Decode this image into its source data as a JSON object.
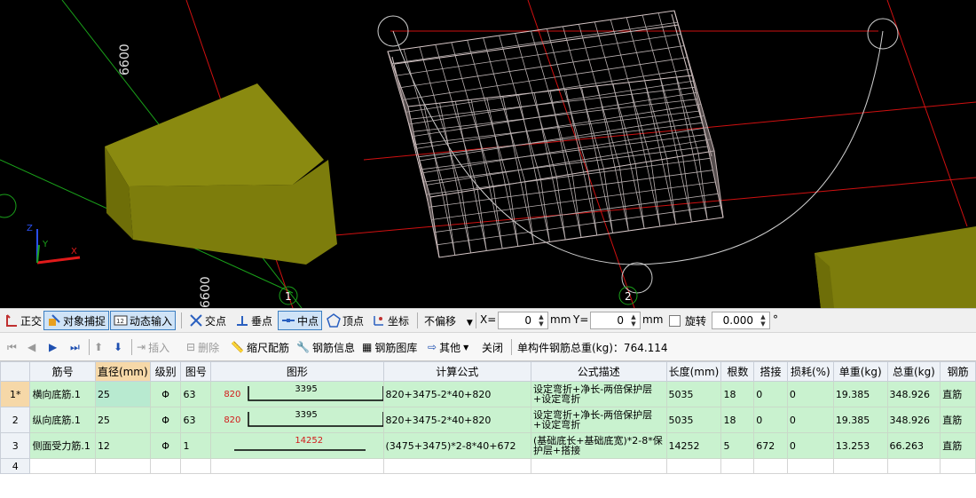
{
  "viewport": {
    "dim_labels": [
      "6600",
      "6600"
    ],
    "axis_labels": {
      "z": "Z",
      "y": "Y",
      "x": "X"
    },
    "grid_bubbles": [
      "1",
      "2"
    ]
  },
  "snap_toolbar": {
    "items": [
      {
        "label": "正交",
        "icon": "orthogonal-icon",
        "active": false
      },
      {
        "label": "对象捕捉",
        "icon": "object-snap-icon",
        "active": true
      },
      {
        "label": "动态输入",
        "icon": "dynamic-input-icon",
        "active": true
      },
      {
        "label": "交点",
        "icon": "intersection-icon",
        "active": false
      },
      {
        "label": "垂点",
        "icon": "perpendicular-icon",
        "active": false
      },
      {
        "label": "中点",
        "icon": "midpoint-icon",
        "active": true
      },
      {
        "label": "顶点",
        "icon": "vertex-icon",
        "active": false
      },
      {
        "label": "坐标",
        "icon": "coordinate-icon",
        "active": false
      }
    ],
    "offset_select": "不偏移",
    "x_label": "X=",
    "x_value": "0",
    "y_label": "Y=",
    "y_value": "0",
    "unit": "mm",
    "rotate_label": "旋转",
    "rotate_value": "0.000",
    "degree": "°"
  },
  "action_toolbar": {
    "insert": "插入",
    "delete": "删除",
    "scale_rebar": "缩尺配筋",
    "rebar_info": "钢筋信息",
    "rebar_library": "钢筋图库",
    "other": "其他",
    "close": "关闭",
    "total_weight_label": "单构件钢筋总重(kg)：764.114"
  },
  "table": {
    "headers": [
      "筋号",
      "直径(mm)",
      "级别",
      "图号",
      "图形",
      "计算公式",
      "公式描述",
      "长度(mm)",
      "根数",
      "搭接",
      "损耗(%)",
      "单重(kg)",
      "总重(kg)",
      "钢筋"
    ],
    "rows": [
      {
        "num": "1*",
        "name": "横向底筋.1",
        "dia": "25",
        "grade": "Φ",
        "fig": "63",
        "shape_left": "820",
        "shape_len": "3395",
        "formula": "820+3475-2*40+820",
        "desc": "设定弯折+净长-两倍保护层+设定弯折",
        "length": "5035",
        "count": "18",
        "lap": "0",
        "loss": "0",
        "unit_w": "19.385",
        "total_w": "348.926",
        "type": "直筋"
      },
      {
        "num": "2",
        "name": "纵向底筋.1",
        "dia": "25",
        "grade": "Φ",
        "fig": "63",
        "shape_left": "820",
        "shape_len": "3395",
        "formula": "820+3475-2*40+820",
        "desc": "设定弯折+净长-两倍保护层+设定弯折",
        "length": "5035",
        "count": "18",
        "lap": "0",
        "loss": "0",
        "unit_w": "19.385",
        "total_w": "348.926",
        "type": "直筋"
      },
      {
        "num": "3",
        "name": "侧面受力筋.1",
        "dia": "12",
        "grade": "Φ",
        "fig": "1",
        "shape_left": "",
        "shape_len": "14252",
        "formula": "(3475+3475)*2-8*40+672",
        "desc": "(基础底长+基础底宽)*2-8*保护层+搭接",
        "length": "14252",
        "count": "5",
        "lap": "672",
        "loss": "0",
        "unit_w": "13.253",
        "total_w": "66.263",
        "type": "直筋"
      }
    ],
    "empty_row_num": "4"
  }
}
